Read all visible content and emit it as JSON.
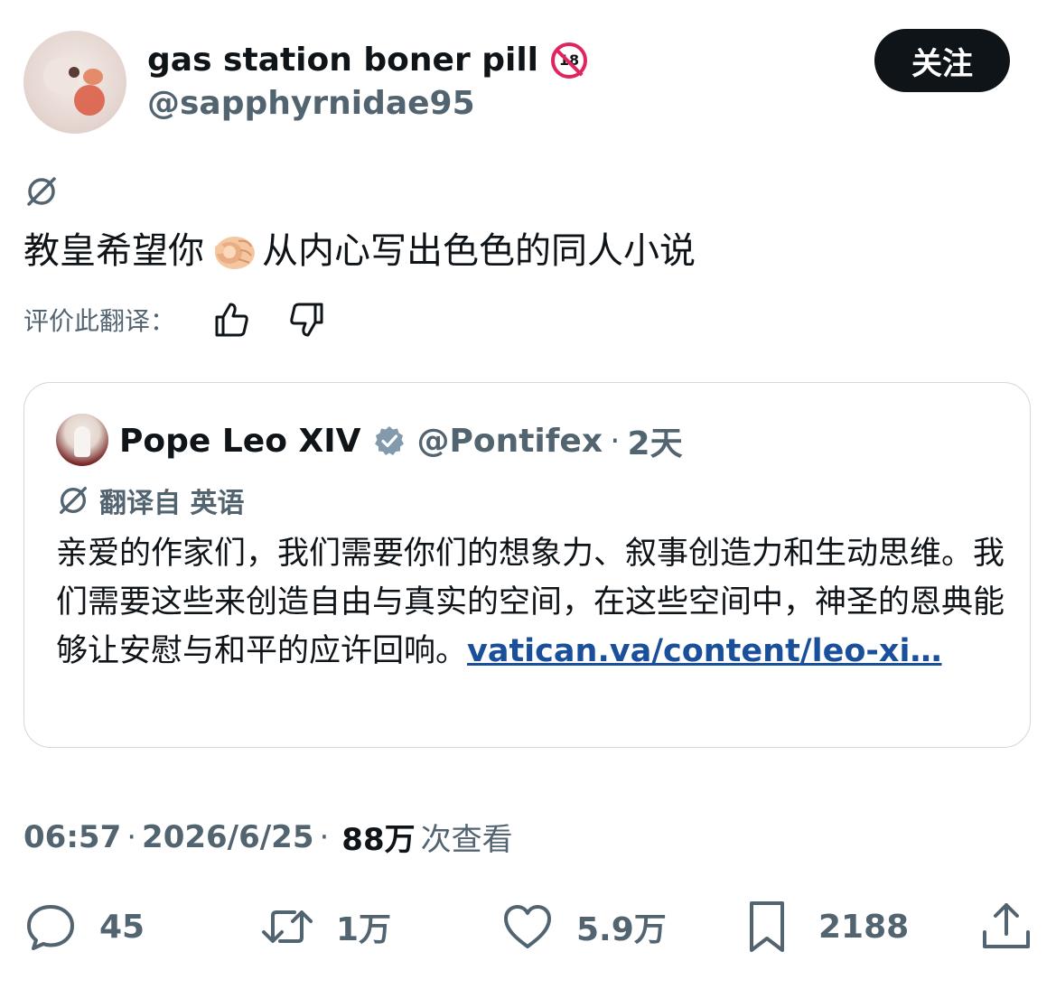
{
  "author": {
    "display_name": "gas station boner pill",
    "badge_text": "18",
    "handle": "@sapphyrnidae95",
    "follow_label": "关注"
  },
  "tweet": {
    "text_before_emoji": "教皇希望你",
    "emoji": "pointing-at-viewer-emoji",
    "text_after_emoji": "从内心写出色色的同人小说",
    "rate_label": "评价此翻译："
  },
  "quote": {
    "name": "Pope Leo XIV",
    "handle": "@Pontifex",
    "separator": "·",
    "time": "2天",
    "translated_label": "翻译自 英语",
    "body": "亲爱的作家们，我们需要你们的想象力、叙事创造力和生动思维。我们需要这些来创造自由与真实的空间，在这些空间中，神圣的恩典能够让安慰与和平的应许回响。",
    "link_text": "vatican.va/content/leo-xi…"
  },
  "meta": {
    "time": "06:57",
    "sep1": "·",
    "date": "2026/6/25",
    "sep2": "·",
    "views": "88万",
    "views_label": "次查看"
  },
  "stats": {
    "replies": "45",
    "reposts": "1万",
    "likes": "5.9万",
    "bookmarks": "2188"
  },
  "colors": {
    "primary_text": "#0f1419",
    "secondary_text": "#536471",
    "link": "#1a4f9c",
    "verified_grey": "#829aab",
    "follow_bg": "#0f1419",
    "badge_red": "#e0245e",
    "border": "#cfd9de"
  }
}
